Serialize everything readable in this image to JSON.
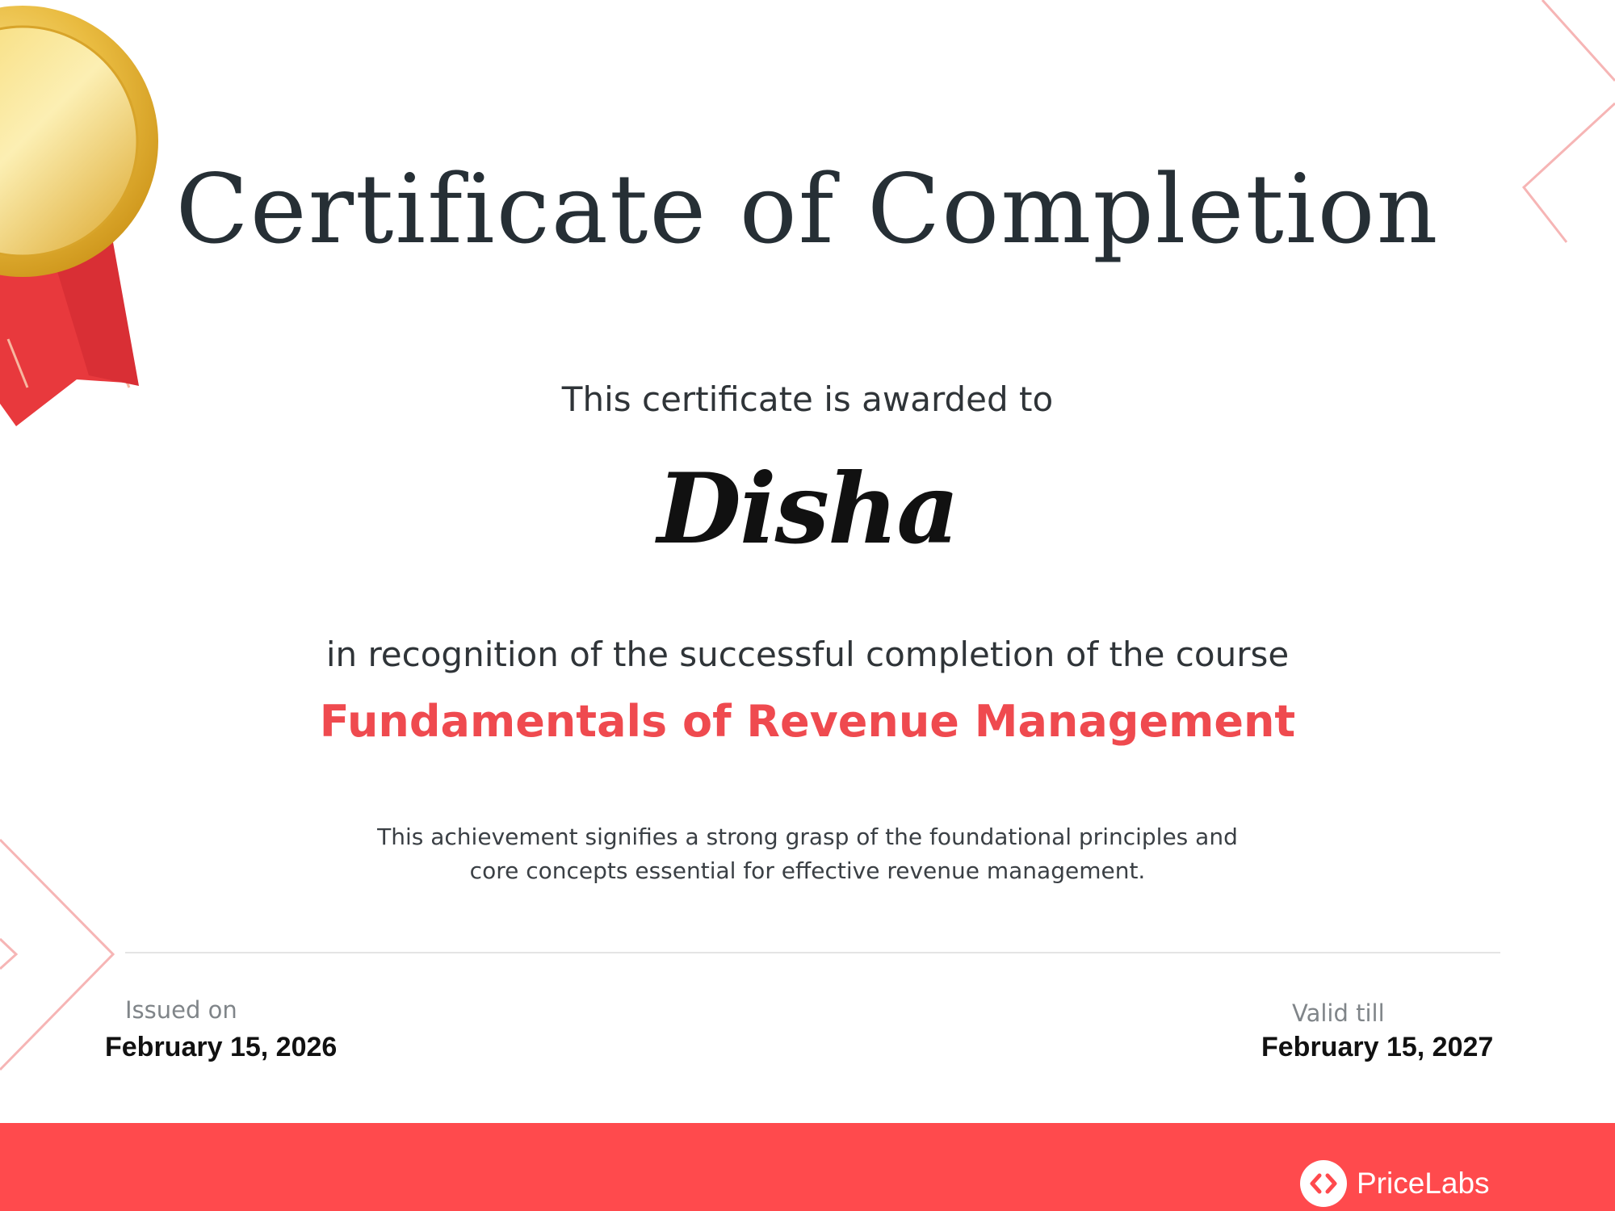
{
  "certificate": {
    "title": "Certificate of Completion",
    "awarded_text": "This certificate is awarded to",
    "recipient_name": "Disha",
    "recognition_text": "in recognition of the successful completion of the course",
    "course_name": "Fundamentals of Revenue Management",
    "description_line1": "This achievement signifies a strong grasp of the foundational principles and",
    "description_line2": "core concepts essential for effective revenue management.",
    "issued_label": "Issued on",
    "issued_date": "February 15, 2026",
    "valid_label": "Valid till",
    "valid_date": "February 15, 2027"
  },
  "footer": {
    "brand_name": "PriceLabs"
  },
  "colors": {
    "accent": "#ef4a4f",
    "footer_bg": "#ff4a4d",
    "title_text": "#262f35",
    "medal_gold": "#e8b73a",
    "ribbon_red": "#e8393d"
  },
  "icons": {
    "medal": "gold-medal-icon",
    "brand_logo": "pricelabs-logo-icon"
  }
}
